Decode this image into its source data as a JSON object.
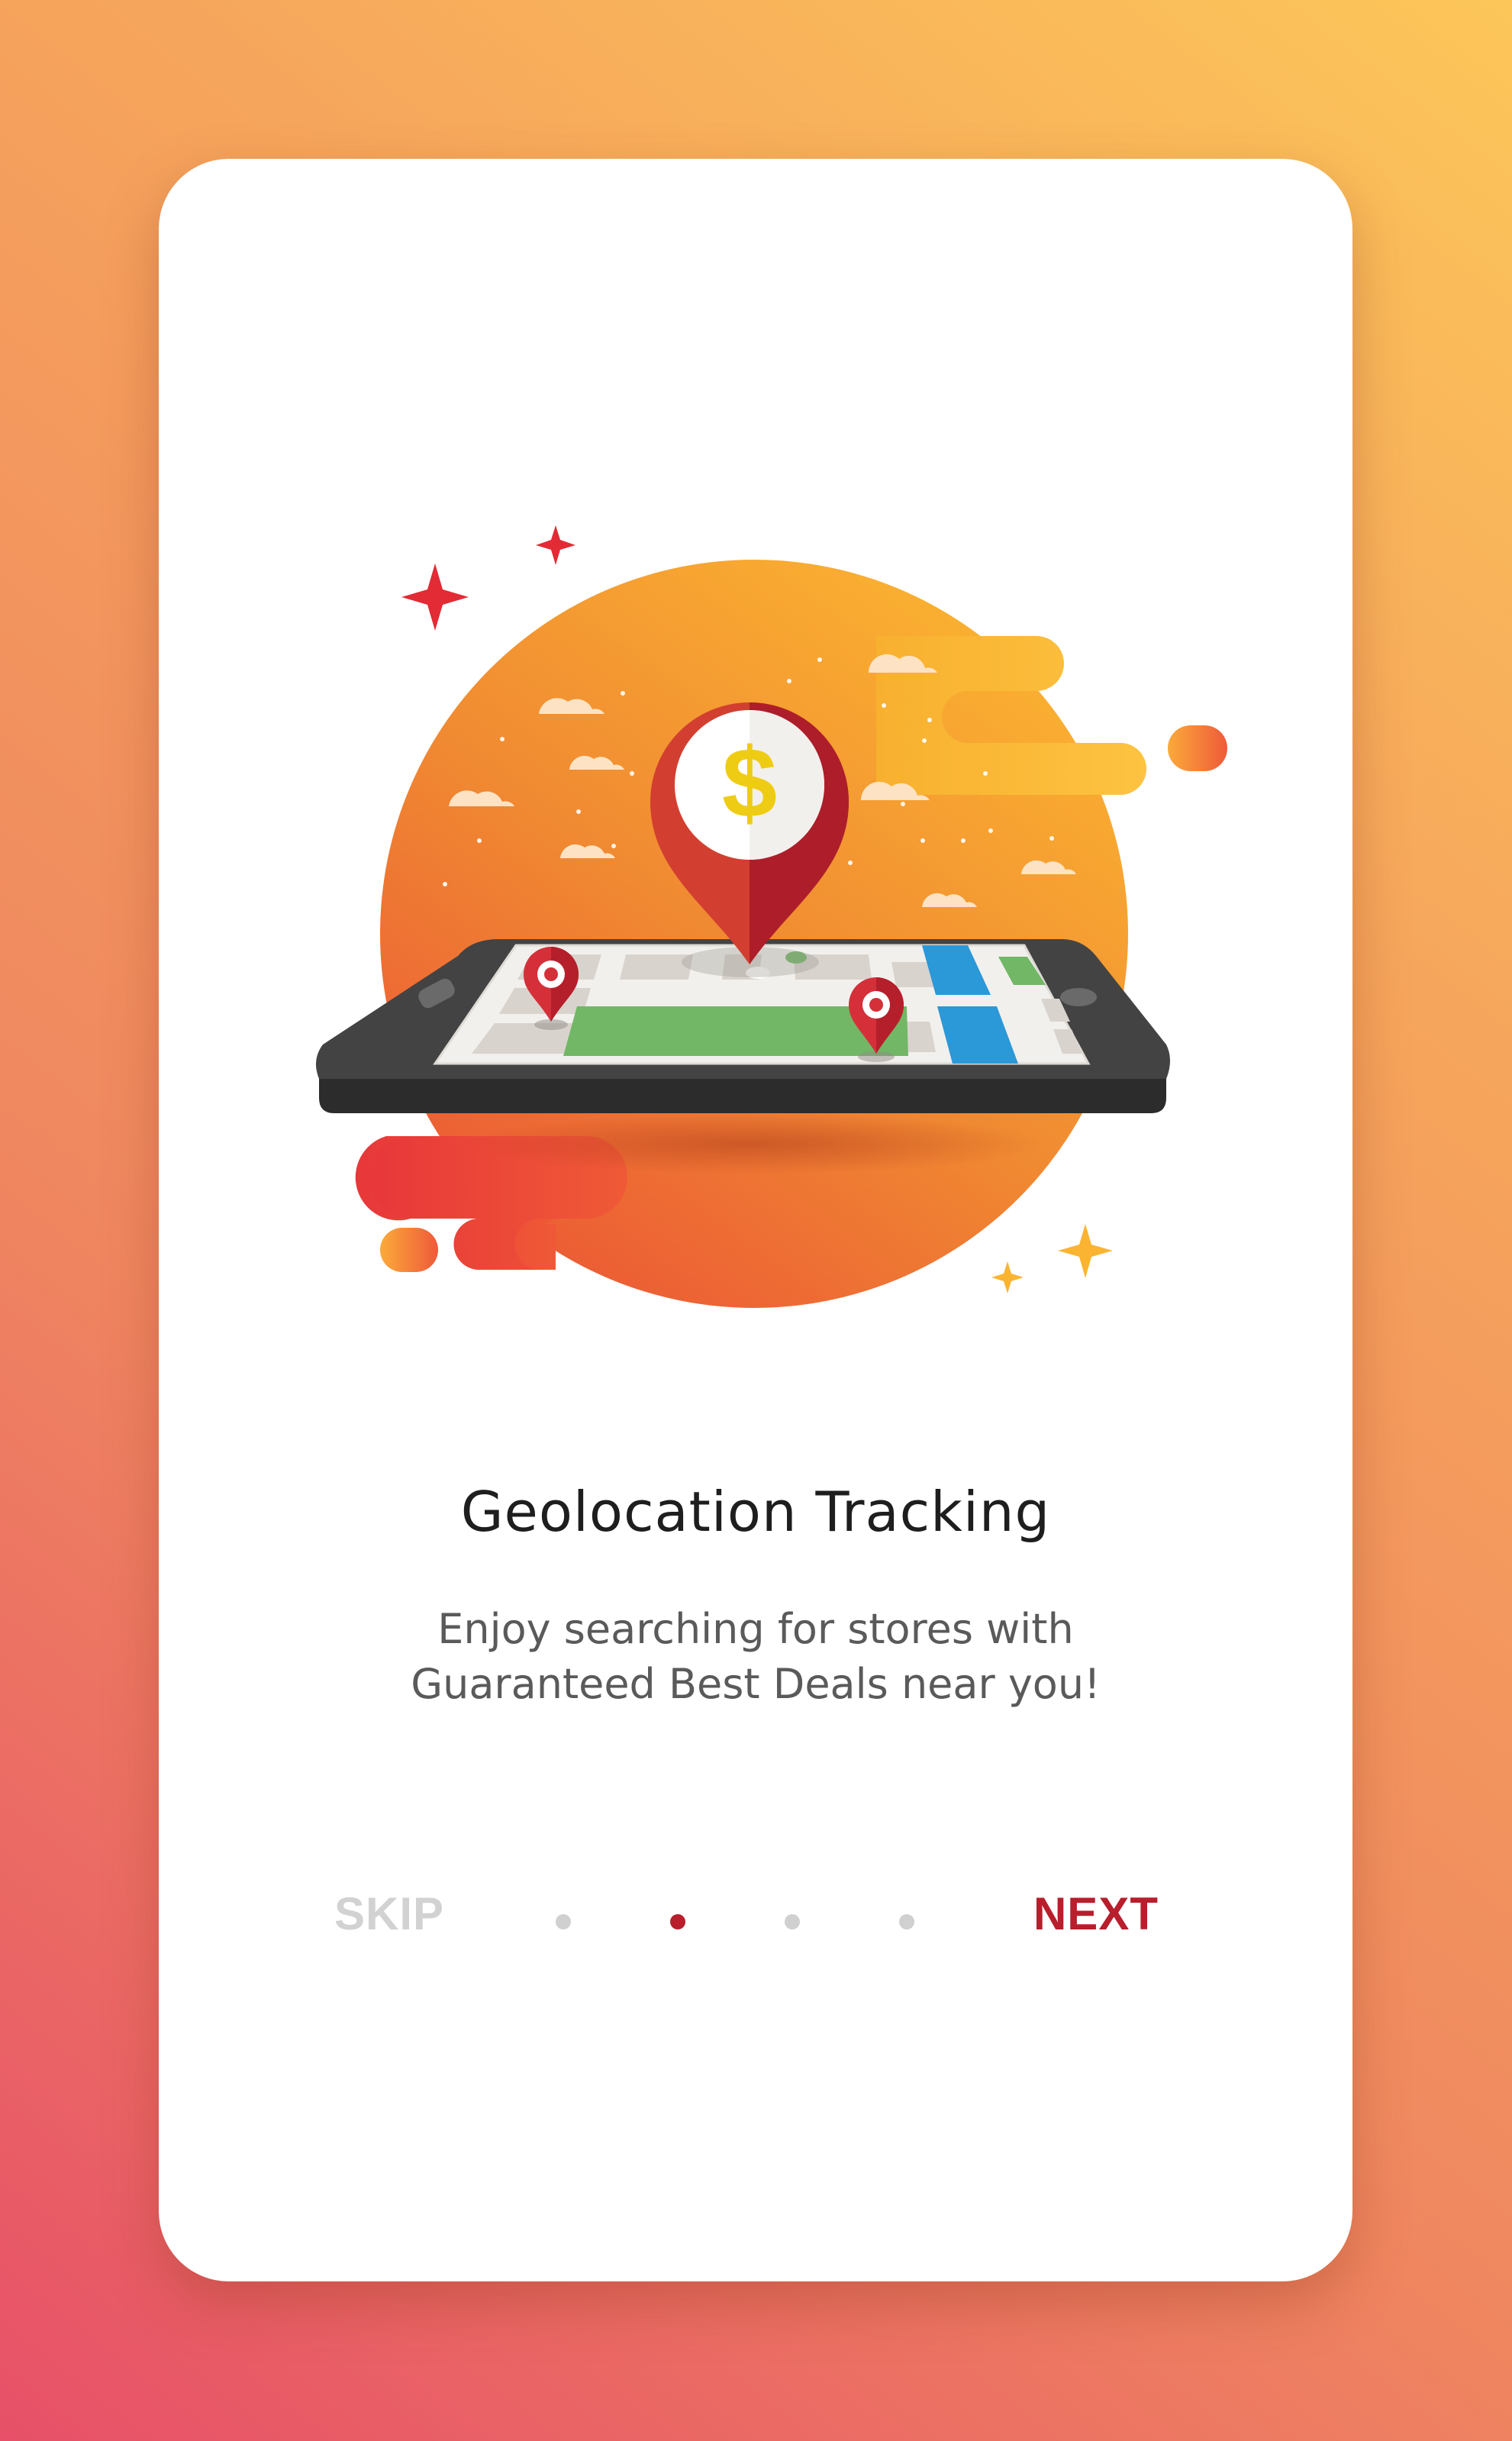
{
  "onboarding": {
    "title": "Geolocation Tracking",
    "description": "Enjoy searching for stores with Guaranteed Best Deals near you!",
    "skip_label": "SKIP",
    "next_label": "NEXT",
    "pagination": {
      "total_pages": 4,
      "current_page": 2
    },
    "illustration": {
      "icons": [
        "dollar-location-pin-icon",
        "location-pin-icon",
        "smartphone-icon",
        "map-icon",
        "cloud-icon",
        "sparkle-star-icon"
      ]
    }
  },
  "colors": {
    "accent": "#b81e2c",
    "inactive_label": "#d2d2d2",
    "dot_active": "#b81e2c",
    "dot_inactive": "#d0d0d0",
    "gradient_top": "#fcc659",
    "gradient_bottom": "#e75068"
  }
}
